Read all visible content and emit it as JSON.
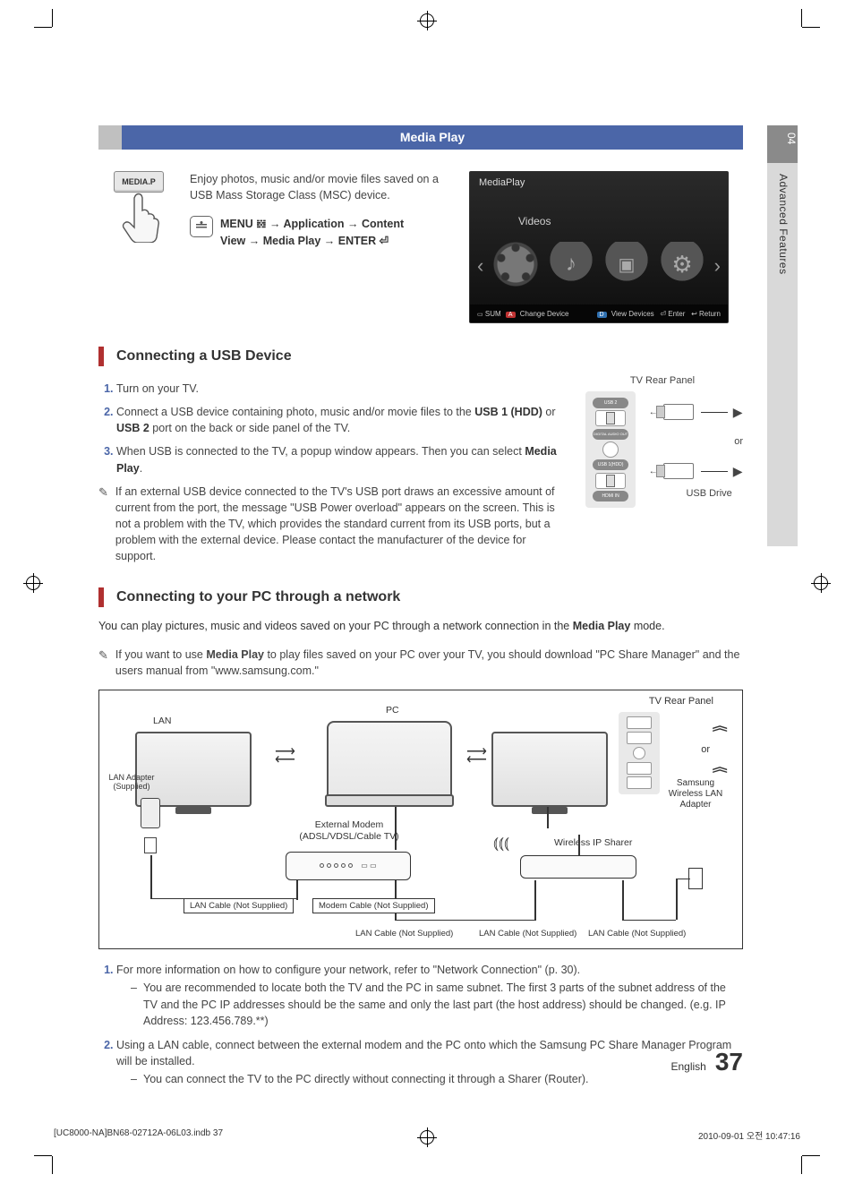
{
  "sidetab": {
    "section_num": "04",
    "section_label": "Advanced Features"
  },
  "topbar": {
    "title": "Media Play"
  },
  "intro": {
    "button_caption": "MEDIA.P",
    "description": "Enjoy photos, music and/or movie files saved on a USB Mass Storage Class (MSC) device.",
    "menupath_line1": "MENU 𝍌 → Application → Content",
    "menupath_line2": "View → Media Play → ENTER ⏎"
  },
  "screenshot": {
    "title": "MediaPlay",
    "tab": "Videos",
    "footer_left_sum": "SUM",
    "footer_badge_a": "A",
    "footer_change": "Change Device",
    "footer_badge_d": "D",
    "footer_view": "View Devices",
    "footer_enter": "⏎ Enter",
    "footer_return": "↩ Return"
  },
  "section_usb": {
    "heading": "Connecting a USB Device",
    "step1": "Turn on your TV.",
    "step2_a": "Connect a USB device containing photo, music and/or movie files to the ",
    "step2_b": "USB 1 (HDD)",
    "step2_c": " or ",
    "step2_d": "USB 2",
    "step2_e": " port on the back or side panel of the TV.",
    "step3_a": "When USB is connected to the TV, a popup window appears. Then you can select ",
    "step3_b": "Media Play",
    "step3_c": ".",
    "note": "If an external USB device connected to the TV's USB port draws an excessive amount of current from the port, the message \"USB Power overload\" appears on the screen. This is not a problem with the TV, which provides the standard current from its USB ports, but a problem with the external device. Please contact the manufacturer of the device for support.",
    "fig_caption": "TV Rear Panel",
    "fig_or": "or",
    "fig_usb_drive": "USB Drive"
  },
  "section_pc": {
    "heading": "Connecting to your PC through a network",
    "intro_a": "You can play pictures, music and videos saved on your PC through a network connection in the ",
    "intro_b": "Media Play",
    "intro_c": " mode.",
    "note_a": "If you want to use ",
    "note_b": "Media Play",
    "note_c": " to play files saved on your PC over your TV, you should download \"PC Share Manager\" and the users manual from \"www.samsung.com.\""
  },
  "diagram": {
    "lan": "LAN",
    "pc": "PC",
    "tv_rear": "TV Rear Panel",
    "or": "or",
    "lan_adapter": "LAN Adapter (Supplied)",
    "external_modem": "External Modem",
    "external_modem2": "(ADSL/VDSL/Cable TV)",
    "wireless_sharer": "Wireless IP Sharer",
    "samsung_wlan": "Samsung Wireless LAN Adapter",
    "lan_cable": "LAN Cable (Not Supplied)",
    "modem_cable": "Modem Cable (Not Supplied)"
  },
  "post_steps": {
    "s1": "For more information on how to configure your network, refer to \"Network Connection\" (p. 30).",
    "s1_sub": "You are recommended to locate both the TV and the PC in same subnet. The first 3 parts of the subnet address of the TV and the PC IP addresses should be the same and only the last part (the host address) should be changed. (e.g. IP Address: 123.456.789.**)",
    "s2": "Using a LAN cable, connect between the external modem and the PC onto which the Samsung PC Share Manager Program will be installed.",
    "s2_sub": "You can connect the TV to the PC directly without connecting it through a Sharer (Router)."
  },
  "footer": {
    "lang": "English",
    "page": "37"
  },
  "printmeta": {
    "left": "[UC8000-NA]BN68-02712A-06L03.indb   37",
    "right": "2010-09-01   오전 10:47:16"
  }
}
